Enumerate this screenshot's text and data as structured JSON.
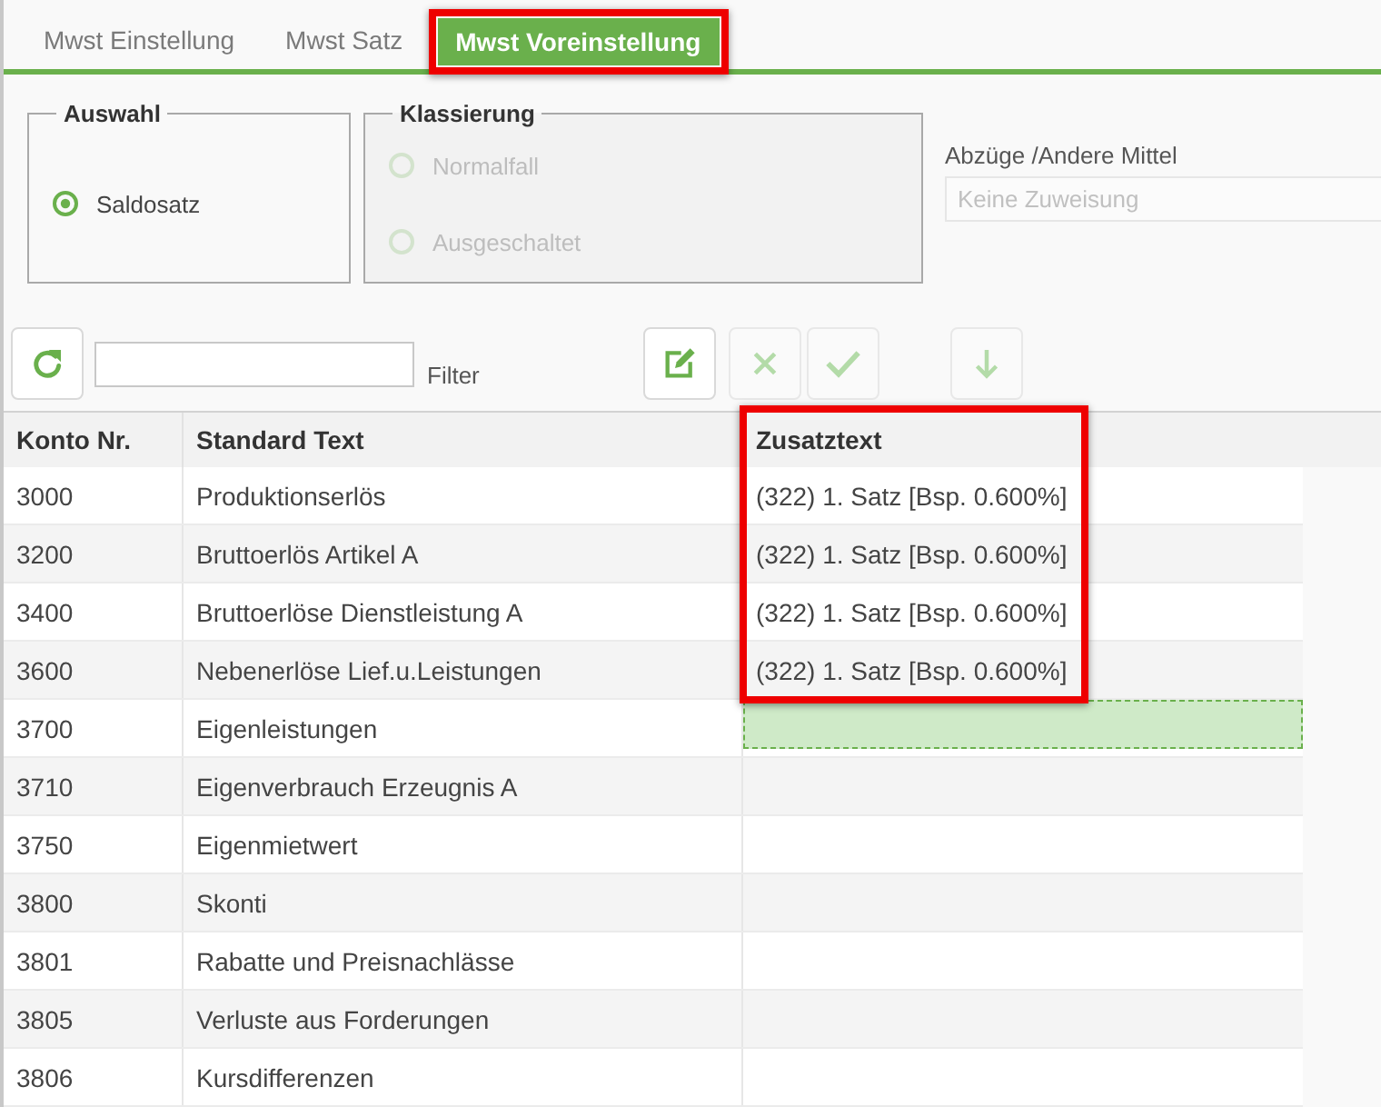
{
  "tabs": [
    {
      "label": "Mwst Einstellung",
      "selected": false,
      "highlighted": false
    },
    {
      "label": "Mwst Satz",
      "selected": false,
      "highlighted": false
    },
    {
      "label": "Mwst Voreinstellung",
      "selected": true,
      "highlighted": true
    }
  ],
  "groups": [
    {
      "legend": "Auswahl",
      "disabled": false,
      "options": [
        {
          "label": "Saldosatz",
          "selected": true
        }
      ]
    },
    {
      "legend": "Klassierung",
      "disabled": true,
      "options": [
        {
          "label": "Normalfall",
          "selected": false
        },
        {
          "label": "Ausgeschaltet",
          "selected": false
        }
      ]
    }
  ],
  "deductions_field": {
    "label": "Abzüge /Andere Mittel",
    "placeholder": "Keine Zuweisung"
  },
  "toolbar": {
    "refresh_button": {
      "disabled": false
    },
    "filter": {
      "label": "Filter"
    },
    "actions": [
      {
        "kind": "edit",
        "disabled": false
      },
      {
        "kind": "cancel",
        "disabled": true
      },
      {
        "kind": "confirm",
        "disabled": true
      },
      {
        "kind": "move_down",
        "disabled": true
      }
    ]
  },
  "table": {
    "columns": [
      {
        "label": "Konto Nr.",
        "highlighted": false
      },
      {
        "label": "Standard Text",
        "highlighted": false
      },
      {
        "label": "Zusatztext",
        "highlighted": true
      }
    ],
    "rows": [
      {
        "cells": [
          "3000",
          "Produktionserlös",
          "(322) 1. Satz [Bsp. 0.600%]"
        ],
        "selected": false,
        "highlighted": true
      },
      {
        "cells": [
          "3200",
          "Bruttoerlös Artikel A",
          "(322) 1. Satz [Bsp. 0.600%]"
        ],
        "selected": false,
        "highlighted": true
      },
      {
        "cells": [
          "3400",
          "Bruttoerlöse Dienstleistung A",
          "(322) 1. Satz [Bsp. 0.600%]"
        ],
        "selected": false,
        "highlighted": true
      },
      {
        "cells": [
          "3600",
          "Nebenerlöse Lief.u.Leistungen",
          "(322) 1. Satz [Bsp. 0.600%]"
        ],
        "selected": false,
        "highlighted": true
      },
      {
        "cells": [
          "3700",
          "Eigenleistungen"
        ],
        "selected": true,
        "highlighted": false
      },
      {
        "cells": [
          "3710",
          "Eigenverbrauch Erzeugnis A"
        ],
        "selected": false,
        "highlighted": false
      },
      {
        "cells": [
          "3750",
          "Eigenmietwert"
        ],
        "selected": false,
        "highlighted": false
      },
      {
        "cells": [
          "3800",
          "Skonti"
        ],
        "selected": false,
        "highlighted": false
      },
      {
        "cells": [
          "3801",
          "Rabatte und Preisnachlässe"
        ],
        "selected": false,
        "highlighted": false
      },
      {
        "cells": [
          "3805",
          "Verluste aus Forderungen"
        ],
        "selected": false,
        "highlighted": false
      },
      {
        "cells": [
          "3806",
          "Kursdifferenzen"
        ],
        "selected": false,
        "highlighted": false
      }
    ]
  }
}
